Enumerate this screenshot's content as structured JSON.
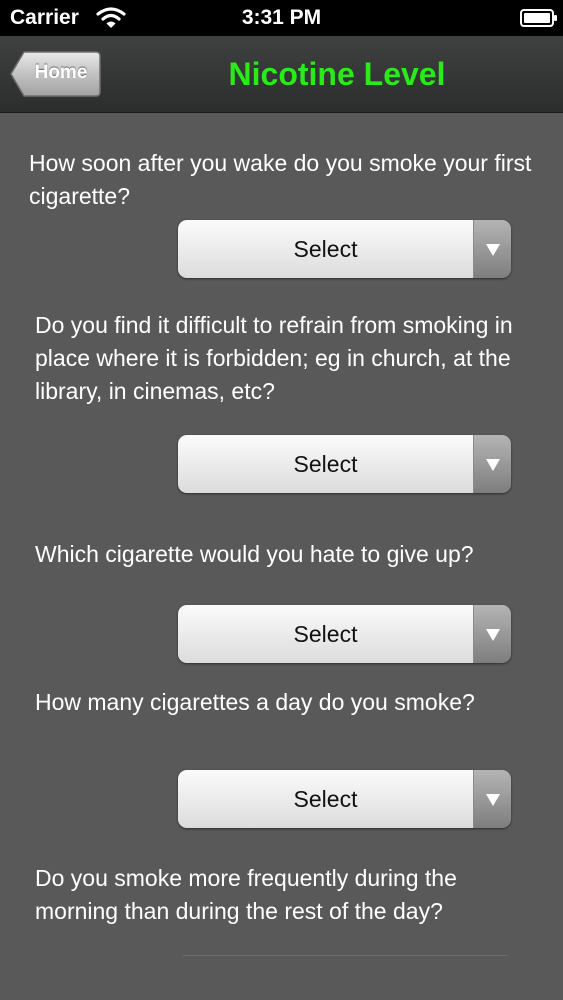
{
  "status_bar": {
    "carrier": "Carrier",
    "time": "3:31 PM"
  },
  "nav": {
    "back_label": "Home",
    "title": "Nicotine Level",
    "title_color": "#2aea1a"
  },
  "questions": [
    {
      "text": "How soon after you wake do you smoke your first cigarette?",
      "select_label": "Select"
    },
    {
      "text": "Do you find it difficult to refrain from smoking in place where it is forbidden; eg in church, at the library, in cinemas, etc?",
      "select_label": "Select"
    },
    {
      "text": "Which cigarette would you hate to give up?",
      "select_label": "Select"
    },
    {
      "text": "How many cigarettes a day do you smoke?",
      "select_label": "Select"
    },
    {
      "text": "Do you smoke more frequently during the morning than during the rest of the day?"
    }
  ],
  "icons": {
    "wifi": "wifi-icon",
    "battery": "battery-icon",
    "dropdown": "chevron-down-icon"
  }
}
